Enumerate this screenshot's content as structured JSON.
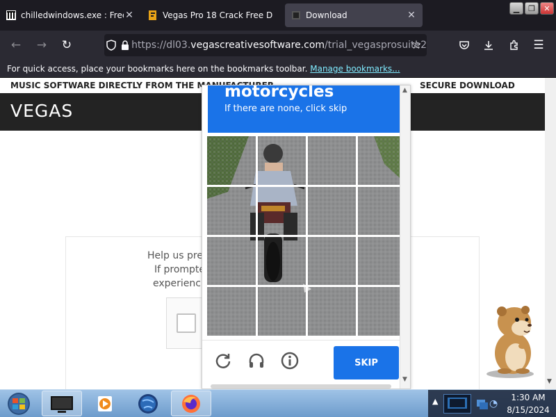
{
  "browser": {
    "tabs": [
      {
        "title": "chilledwindows.exe : Free D",
        "icon": "archive-org-icon"
      },
      {
        "title": "Vegas Pro 18 Crack Free D",
        "icon": "vegas-favicon-icon"
      },
      {
        "title": "Download",
        "icon": "page-favicon-icon",
        "active": true
      }
    ],
    "url_prefix": "https://dl03.",
    "url_domain": "vegascreativesoftware.com",
    "url_path": "/trial_vegasprosuite2",
    "bookmarks_message": "For quick access, place your bookmarks here on the bookmarks toolbar.",
    "bookmarks_link": "Manage bookmarks..."
  },
  "page": {
    "top_left": "MUSIC SOFTWARE DIRECTLY FROM THE MANUFACTURER",
    "top_right": "SECURE DOWNLOAD SERVER",
    "logo": "VEGAS",
    "help_lines": [
      "Help us prev",
      "If prompted",
      "experiencin"
    ]
  },
  "captcha": {
    "target": "motorcycles",
    "subtitle": "If there are none, click skip",
    "skip_label": "SKIP",
    "icons": [
      "reload-icon",
      "headphones-icon",
      "info-icon"
    ]
  },
  "taskbar": {
    "time": "1:30 AM",
    "date": "8/15/2024"
  },
  "colors": {
    "captcha_blue": "#1a73e8",
    "tab_bar": "#1c1b22",
    "nav_bar": "#2b2a33",
    "page_header": "#232323"
  }
}
